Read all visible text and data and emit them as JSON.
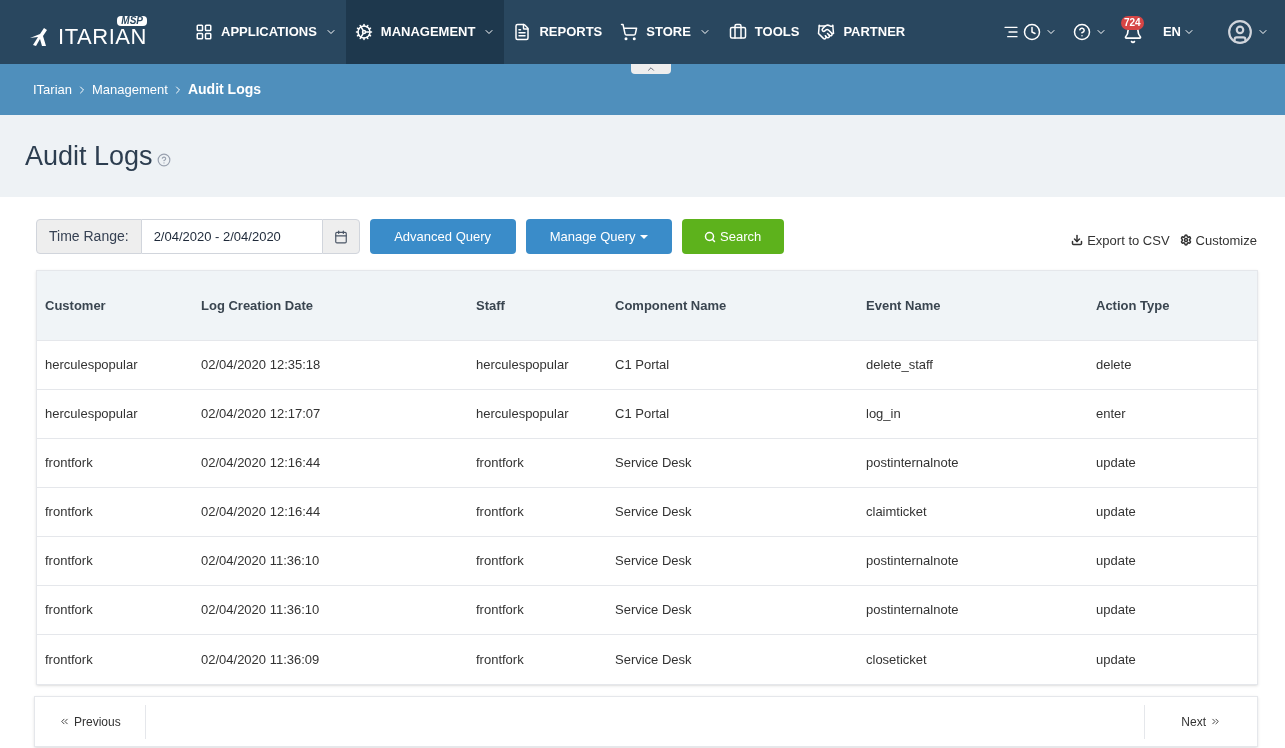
{
  "nav": {
    "logo_badge": "MSP",
    "logo": "ITARIAN",
    "items": [
      {
        "label": "APPLICATIONS",
        "kind": "grid",
        "dropdown": true,
        "selected": false
      },
      {
        "label": "MANAGEMENT",
        "kind": "gears",
        "dropdown": true,
        "selected": true
      },
      {
        "label": "REPORTS",
        "kind": "report",
        "dropdown": false,
        "selected": false
      },
      {
        "label": "STORE",
        "kind": "cart",
        "dropdown": true,
        "selected": false
      },
      {
        "label": "TOOLS",
        "kind": "briefcase",
        "dropdown": false,
        "selected": false
      },
      {
        "label": "PARTNER",
        "kind": "handshake",
        "dropdown": false,
        "selected": false
      }
    ],
    "notification_count": "724",
    "language": "EN"
  },
  "breadcrumb": [
    {
      "label": "ITarian",
      "current": false
    },
    {
      "label": "Management",
      "current": false
    },
    {
      "label": "Audit Logs",
      "current": true
    }
  ],
  "page_title": "Audit Logs",
  "toolbar": {
    "time_range_label": "Time Range:",
    "time_range_value": "2/04/2020 - 2/04/2020",
    "buttons": [
      {
        "label": "Advanced Query",
        "kind": "primary",
        "dropdown": false
      },
      {
        "label": "Manage Query",
        "kind": "primary",
        "dropdown": true
      },
      {
        "label": "Search",
        "kind": "success",
        "dropdown": false
      }
    ],
    "links": [
      {
        "label": "Export to CSV",
        "kind": "download"
      },
      {
        "label": "Customize",
        "kind": "settings"
      }
    ]
  },
  "table": {
    "columns": [
      "Customer",
      "Log Creation Date",
      "Staff",
      "Component Name",
      "Event Name",
      "Action Type"
    ],
    "rows": [
      [
        "herculespopular",
        "02/04/2020 12:35:18",
        "herculespopular",
        "C1 Portal",
        "delete_staff",
        "delete"
      ],
      [
        "herculespopular",
        "02/04/2020 12:17:07",
        "herculespopular",
        "C1 Portal",
        "log_in",
        "enter"
      ],
      [
        "frontfork",
        "02/04/2020 12:16:44",
        "frontfork",
        "Service Desk",
        "postinternalnote",
        "update"
      ],
      [
        "frontfork",
        "02/04/2020 12:16:44",
        "frontfork",
        "Service Desk",
        "claimticket",
        "update"
      ],
      [
        "frontfork",
        "02/04/2020 11:36:10",
        "frontfork",
        "Service Desk",
        "postinternalnote",
        "update"
      ],
      [
        "frontfork",
        "02/04/2020 11:36:10",
        "frontfork",
        "Service Desk",
        "postinternalnote",
        "update"
      ],
      [
        "frontfork",
        "02/04/2020 11:36:09",
        "frontfork",
        "Service Desk",
        "closeticket",
        "update"
      ]
    ]
  },
  "pagination": {
    "previous": "Previous",
    "next": "Next"
  }
}
